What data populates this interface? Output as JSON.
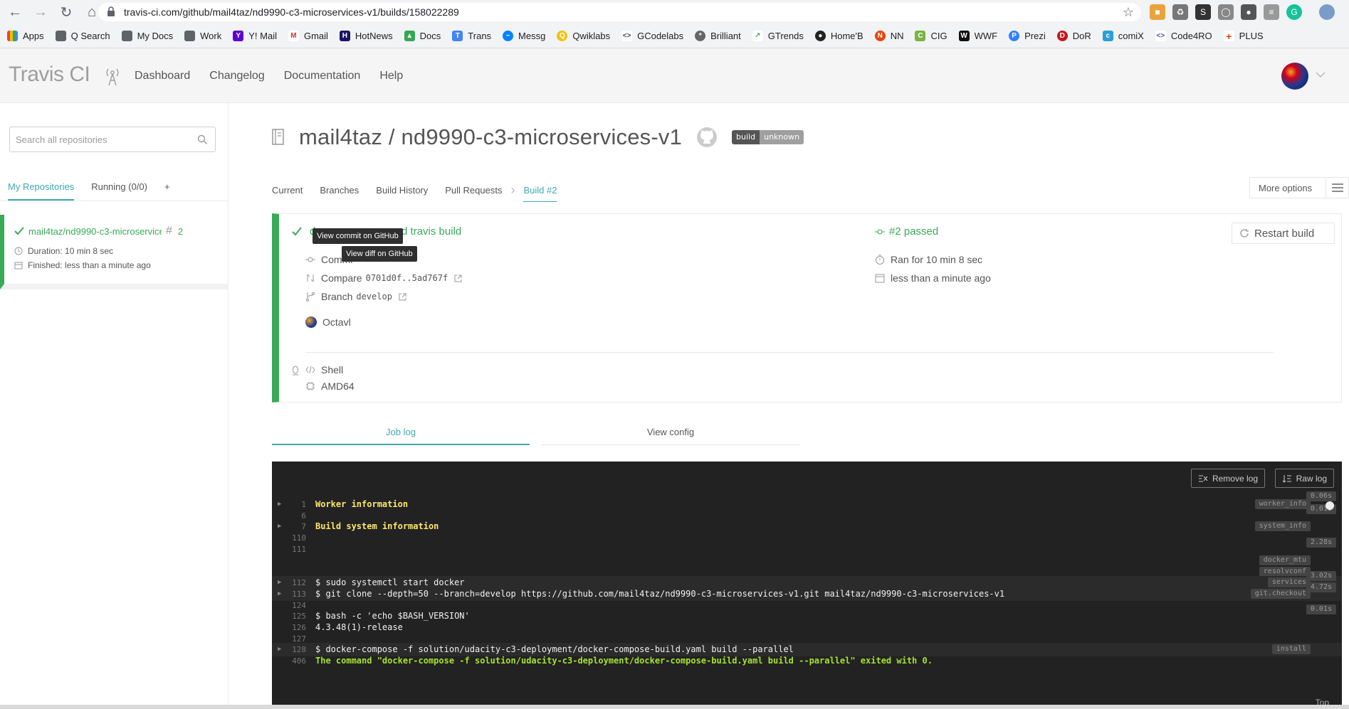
{
  "browser": {
    "url": "travis-ci.com/github/mail4taz/nd9990-c3-microservices-v1/builds/158022289",
    "bookmarks": [
      "Apps",
      "Q Search",
      "My Docs",
      "Work",
      "Y! Mail",
      "Gmail",
      "HotNews",
      "Docs",
      "Trans",
      "Messg",
      "Qwiklabs",
      "GCodelabs",
      "Brilliant",
      "GTrends",
      "Home'B",
      "NN",
      "CIG",
      "WWF",
      "Prezi",
      "DoR",
      "comiX",
      "Code4RO",
      "PLUS"
    ]
  },
  "header": {
    "logo": "Travis CI",
    "nav": [
      "Dashboard",
      "Changelog",
      "Documentation",
      "Help"
    ]
  },
  "sidebar": {
    "search_placeholder": "Search all repositories",
    "tabs": [
      "My Repositories",
      "Running (0/0)",
      "+"
    ],
    "repo": {
      "name": "mail4taz/nd9990-c3-microservices-v1",
      "build_number": "2",
      "duration": "Duration: 10 min 8 sec",
      "finished": "Finished: less than a minute ago"
    }
  },
  "main": {
    "repo_title": "mail4taz / nd9990-c3-microservices-v1",
    "badge": {
      "left": "build",
      "right": "unknown"
    },
    "tabs": [
      "Current",
      "Branches",
      "Build History",
      "Pull Requests"
    ],
    "active_tab": "Build #2",
    "more_options": "More options",
    "build": {
      "message_prefix": "de",
      "message_suffix": "ed travis build",
      "commit_label": "Commi",
      "compare_label": "Compare",
      "compare_value": "0701d0f..5ad767f",
      "branch_label": "Branch",
      "branch_value": "develop",
      "author": "Octavl",
      "status": "#2 passed",
      "ran_for": "Ran for 10 min 8 sec",
      "finished": "less than a minute ago",
      "restart": "Restart build",
      "language": "Shell",
      "arch": "AMD64",
      "tooltip_commit": "View commit on GitHub",
      "tooltip_diff": "View diff on GitHub"
    },
    "log_tabs": [
      "Job log",
      "View config"
    ],
    "log_buttons": [
      "Remove log",
      "Raw log"
    ],
    "log_lines": [
      {
        "n": "1",
        "text": "Worker information",
        "style": "yellow",
        "arrow": true,
        "tag": "worker_info",
        "time": "0.06s"
      },
      {
        "n": "6",
        "text": "",
        "tag": "",
        "time": "0.01s"
      },
      {
        "n": "7",
        "text": "Build system information",
        "style": "yellow",
        "arrow": true,
        "tag": "system_info",
        "time": ""
      },
      {
        "n": "110",
        "text": "",
        "tag": "",
        "time": ""
      },
      {
        "n": "111",
        "text": "",
        "tag": "",
        "time": "2.28s"
      },
      {
        "n": "",
        "text": "",
        "tag": "docker_mtu",
        "time": ""
      },
      {
        "n": "",
        "text": "",
        "tag": "resolvconf",
        "time": ""
      },
      {
        "n": "112",
        "text": "$ sudo systemctl start docker",
        "arrow": true,
        "tag": "services",
        "time": "3.02s",
        "hl": true
      },
      {
        "n": "113",
        "text": "$ git clone --depth=50 --branch=develop https://github.com/mail4taz/nd9990-c3-microservices-v1.git mail4taz/nd9990-c3-microservices-v1",
        "arrow": true,
        "tag": "git.checkout",
        "time": "4.72s",
        "hl": true
      },
      {
        "n": "124",
        "text": "",
        "tag": "",
        "time": ""
      },
      {
        "n": "125",
        "text": "$ bash -c 'echo $BASH_VERSION'",
        "tag": "",
        "time": "0.01s"
      },
      {
        "n": "126",
        "text": "4.3.48(1)-release",
        "tag": "",
        "time": ""
      },
      {
        "n": "127",
        "text": "",
        "tag": "",
        "time": ""
      },
      {
        "n": "128",
        "text": "$ docker-compose -f solution/udacity-c3-deployment/docker-compose-build.yaml build --parallel",
        "arrow": true,
        "tag": "install",
        "time": "",
        "hl": true
      },
      {
        "n": "406",
        "text": "The command \"docker-compose -f solution/udacity-c3-deployment/docker-compose-build.yaml build --parallel\" exited with 0.",
        "style": "green",
        "tag": "",
        "time": ""
      }
    ],
    "log_top": "Top"
  },
  "colors": {
    "passed": "#39aa56",
    "accent": "#3eaaaf",
    "log_bg": "#222222"
  }
}
